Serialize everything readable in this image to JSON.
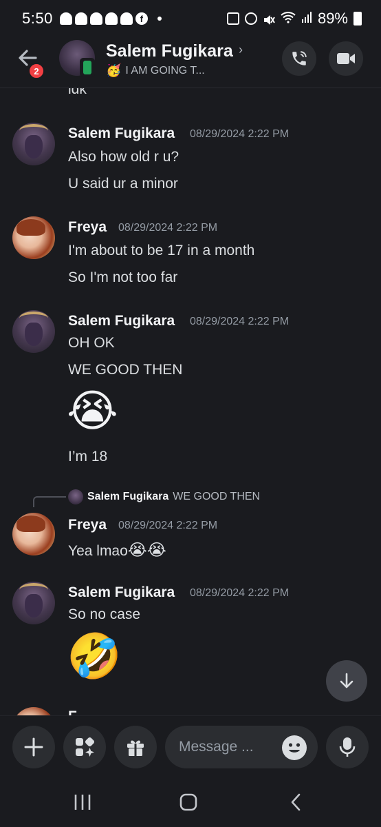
{
  "status_bar": {
    "time": "5:50",
    "battery": "89%"
  },
  "header": {
    "contact_name": "Salem Fugikara",
    "status_text": "I AM GOING T...",
    "status_emoji": "🥳",
    "unread_badge": "2"
  },
  "chat": {
    "cut_off_text": "idk",
    "messages": [
      {
        "author": "Salem Fugikara",
        "timestamp": "08/29/2024 2:22 PM",
        "lines": [
          "Also how old r u?",
          "U said ur a minor"
        ]
      },
      {
        "author": "Freya",
        "timestamp": "08/29/2024 2:22 PM",
        "lines": [
          "I'm about to be 17 in a month",
          "So I'm not too far"
        ]
      },
      {
        "author": "Salem Fugikara",
        "timestamp": "08/29/2024 2:22 PM",
        "lines": [
          "OH OK",
          "WE GOOD THEN",
          "😭",
          "I’m 18"
        ]
      },
      {
        "author": "Freya",
        "timestamp": "08/29/2024 2:22 PM",
        "reply_to": {
          "author": "Salem Fugikara",
          "text": "WE GOOD THEN"
        },
        "lines": [
          "Yea lmao",
          "😭😭"
        ]
      },
      {
        "author": "Salem Fugikara",
        "timestamp": "08/29/2024 2:22 PM",
        "lines": [
          "So no case",
          "🤣"
        ]
      }
    ],
    "partial_author": "F"
  },
  "composer": {
    "placeholder": "Message ..."
  },
  "colors": {
    "background": "#1a1b1f",
    "surface": "#2b2d31",
    "text": "#f2f3f5",
    "muted": "#949ba4",
    "badge": "#f23f43",
    "online": "#23a55a"
  }
}
